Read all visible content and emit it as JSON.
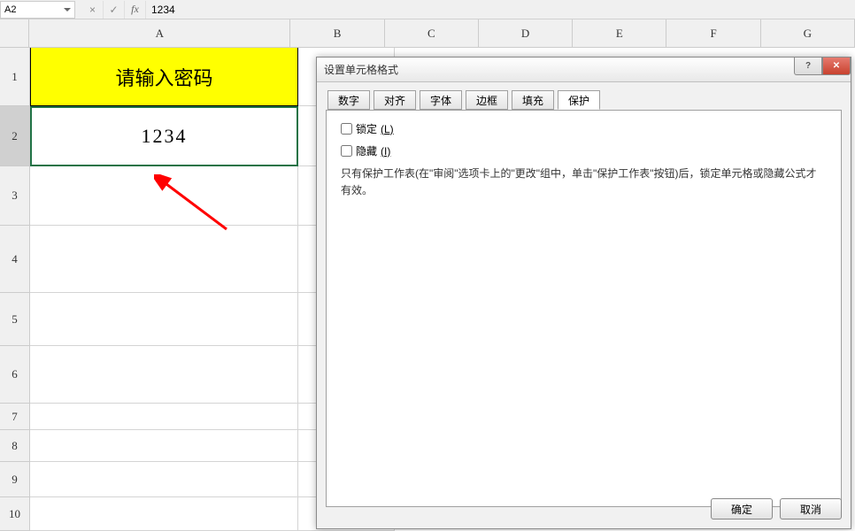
{
  "formula_bar": {
    "cell_ref": "A2",
    "fx_label": "fx",
    "cancel_icon": "×",
    "confirm_icon": "✓",
    "formula_value": "1234"
  },
  "columns": {
    "A": "A",
    "B": "B",
    "C": "C",
    "D": "D",
    "E": "E",
    "F": "F",
    "G": "G"
  },
  "rows": [
    "1",
    "2",
    "3",
    "4",
    "5",
    "6",
    "7",
    "8",
    "9",
    "10"
  ],
  "cells": {
    "A1": "请输入密码",
    "A2": "1234"
  },
  "dialog": {
    "title": "设置单元格格式",
    "help_symbol": "?",
    "close_symbol": "✕",
    "tabs": {
      "number": "数字",
      "align": "对齐",
      "font": "字体",
      "border": "边框",
      "fill": "填充",
      "protect": "保护"
    },
    "protect_panel": {
      "lock_label": "锁定",
      "lock_accel": "(L)",
      "hide_label": "隐藏",
      "hide_accel": "(I)",
      "note": "只有保护工作表(在\"审阅\"选项卡上的\"更改\"组中，单击\"保护工作表\"按钮)后，锁定单元格或隐藏公式才有效。"
    },
    "buttons": {
      "ok": "确定",
      "cancel": "取消"
    }
  }
}
